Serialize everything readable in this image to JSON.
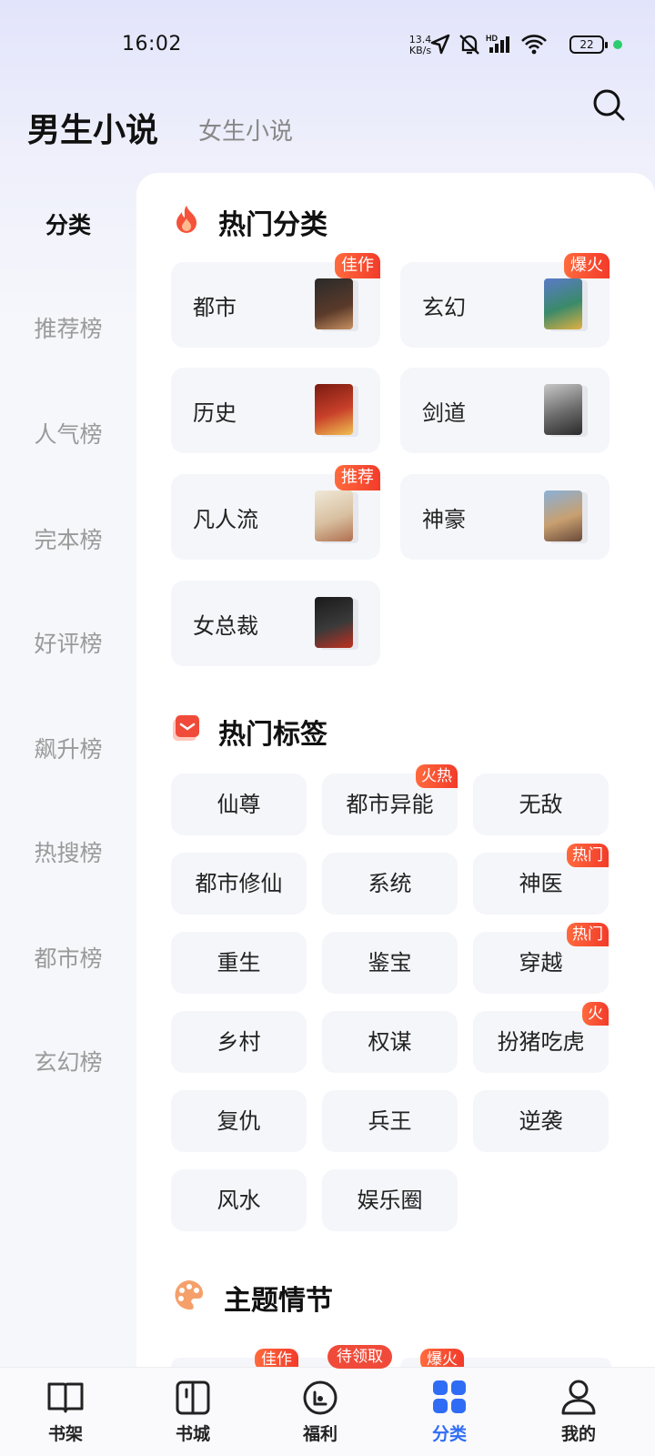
{
  "status": {
    "time": "16:02",
    "speed_top": "13.4",
    "speed_bottom": "KB/s",
    "battery": "22"
  },
  "header": {
    "tab_male": "男生小说",
    "tab_female": "女生小说"
  },
  "sidebar": {
    "items": [
      {
        "label": "分类"
      },
      {
        "label": "推荐榜"
      },
      {
        "label": "人气榜"
      },
      {
        "label": "完本榜"
      },
      {
        "label": "好评榜"
      },
      {
        "label": "飙升榜"
      },
      {
        "label": "热搜榜"
      },
      {
        "label": "都市榜"
      },
      {
        "label": "玄幻榜"
      }
    ]
  },
  "hot_categories": {
    "title": "热门分类",
    "items": [
      {
        "label": "都市",
        "badge": "佳作"
      },
      {
        "label": "玄幻",
        "badge": "爆火"
      },
      {
        "label": "历史"
      },
      {
        "label": "剑道"
      },
      {
        "label": "凡人流",
        "badge": "推荐"
      },
      {
        "label": "神豪"
      },
      {
        "label": "女总裁"
      }
    ]
  },
  "hot_tags": {
    "title": "热门标签",
    "items": [
      {
        "label": "仙尊"
      },
      {
        "label": "都市异能",
        "badge": "火热"
      },
      {
        "label": "无敌"
      },
      {
        "label": "都市修仙"
      },
      {
        "label": "系统"
      },
      {
        "label": "神医",
        "badge": "热门"
      },
      {
        "label": "重生"
      },
      {
        "label": "鉴宝"
      },
      {
        "label": "穿越",
        "badge": "热门"
      },
      {
        "label": "乡村"
      },
      {
        "label": "权谋"
      },
      {
        "label": "扮猪吃虎",
        "badge": "火"
      },
      {
        "label": "复仇"
      },
      {
        "label": "兵王"
      },
      {
        "label": "逆袭"
      },
      {
        "label": "风水"
      },
      {
        "label": "娱乐圈"
      }
    ]
  },
  "theme": {
    "title": "主题情节",
    "peek_badges": [
      "佳作",
      "爆火"
    ]
  },
  "tabbar": {
    "items": [
      {
        "label": "书架"
      },
      {
        "label": "书城"
      },
      {
        "label": "福利"
      },
      {
        "label": "分类"
      },
      {
        "label": "我的"
      }
    ],
    "welfare_badge": "待领取"
  },
  "colors": {
    "accent": "#2f6cf6",
    "badge": "#f23b2a"
  }
}
